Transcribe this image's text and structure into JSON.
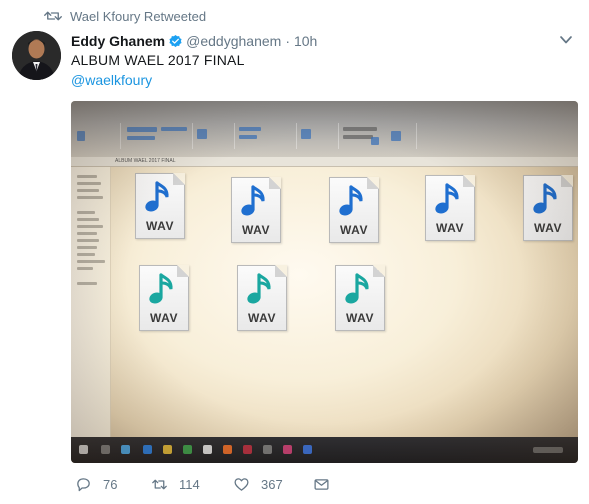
{
  "retweet_context": {
    "text": "Wael Kfoury Retweeted"
  },
  "tweet": {
    "author_name": "Eddy Ghanem",
    "author_handle": "@eddyghanem",
    "separator": "·",
    "time": "10h",
    "text": "ALBUM WAEL 2017 FINAL",
    "mention": "@waelkfoury",
    "verified": true
  },
  "photo": {
    "address_path": "ALBUM WAEL 2017 FINAL",
    "files": [
      {
        "ext": "WAV"
      },
      {
        "ext": "WAV"
      },
      {
        "ext": "WAV"
      },
      {
        "ext": "WAV"
      },
      {
        "ext": "WAV"
      },
      {
        "ext": "WAV"
      },
      {
        "ext": "WAV"
      },
      {
        "ext": "WAV"
      }
    ]
  },
  "actions": {
    "reply_count": "76",
    "retweet_count": "114",
    "like_count": "367"
  },
  "colors": {
    "link": "#1b95e0",
    "secondary_text": "#657786",
    "wav_note_blue": "#1f6fd0",
    "wav_note_teal": "#1aa7a0"
  }
}
